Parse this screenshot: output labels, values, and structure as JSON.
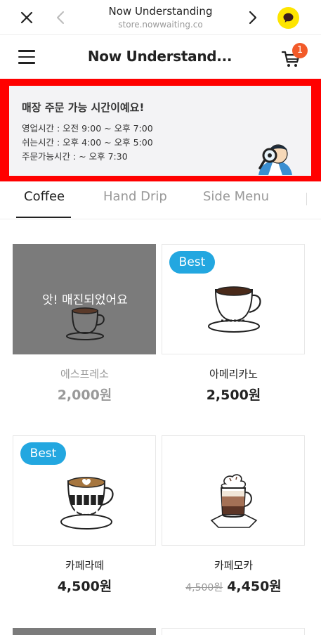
{
  "browser": {
    "title": "Now Understanding",
    "url": "store.nowwaiting.co"
  },
  "header": {
    "title": "Now Understand...",
    "cart_count": "1"
  },
  "banner": {
    "title": "매장 주문 가능 시간이예요!",
    "lines": [
      "영업시간 : 오전 9:00 ~ 오후 7:00",
      "쉬는시간 : 오후 4:00 ~ 오후 5:00",
      "주문가능시간 : ~ 오후 7:30"
    ]
  },
  "tabs": [
    {
      "label": "Coffee",
      "active": true
    },
    {
      "label": "Hand Drip",
      "active": false
    },
    {
      "label": "Side Menu",
      "active": false
    }
  ],
  "products": [
    {
      "name": "에스프레소",
      "price": "2,000원",
      "sold_out": true,
      "sold_out_label": "앗! 매진되었어요",
      "badge": "",
      "icon": "espresso-cup-icon"
    },
    {
      "name": "아메리카노",
      "price": "2,500원",
      "sold_out": false,
      "badge": "Best",
      "icon": "americano-cup-icon"
    },
    {
      "name": "카페라떼",
      "price": "4,500원",
      "sold_out": false,
      "badge": "Best",
      "icon": "latte-cup-icon"
    },
    {
      "name": "카페모카",
      "original_price": "4,500원",
      "price": "4,450원",
      "sold_out": false,
      "badge": "",
      "icon": "mocha-glass-icon"
    }
  ],
  "colors": {
    "badge": "#23a7e0",
    "cart_badge": "#f25a29",
    "kakao": "#FEE500",
    "highlight_frame": "#ff0000",
    "sold_out_overlay": "#7b7b7b"
  }
}
